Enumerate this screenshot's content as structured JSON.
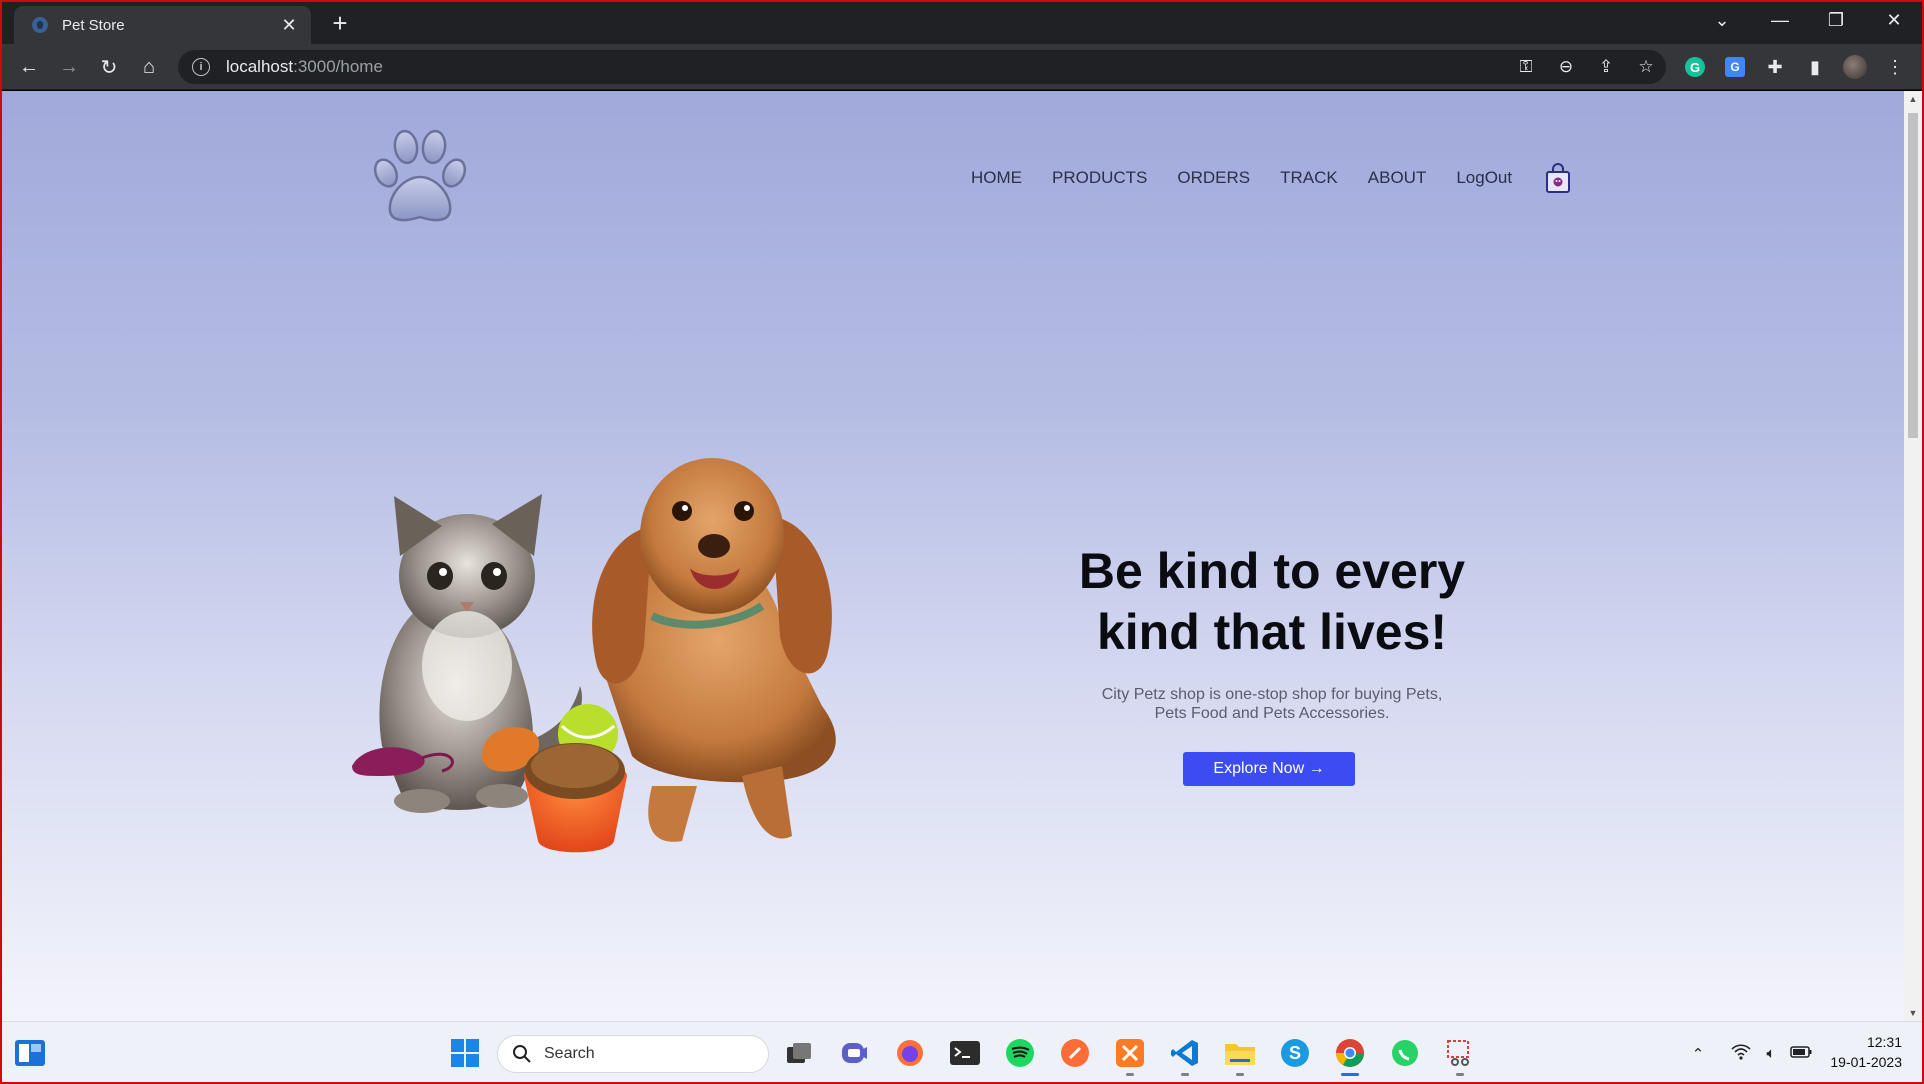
{
  "browser": {
    "tab_title": "Pet Store",
    "url_host": "localhost",
    "url_path": ":3000/home"
  },
  "site": {
    "nav": [
      "HOME",
      "PRODUCTS",
      "ORDERS",
      "TRACK",
      "ABOUT",
      "LogOut"
    ],
    "hero_title_line1": "Be kind to every",
    "hero_title_line2": "kind that lives!",
    "hero_desc_line1": "City Petz shop is one-stop shop for buying Pets,",
    "hero_desc_line2": "Pets Food and Pets Accessories.",
    "cta_label": "Explore Now →"
  },
  "taskbar": {
    "search_placeholder": "Search",
    "time": "12:31",
    "date": "19-01-2023"
  },
  "colors": {
    "accent": "#3c4cf0",
    "frame": "#d00a0a",
    "page_gradient_top": "#a1a9db",
    "page_gradient_bottom": "#f3f4fb"
  }
}
